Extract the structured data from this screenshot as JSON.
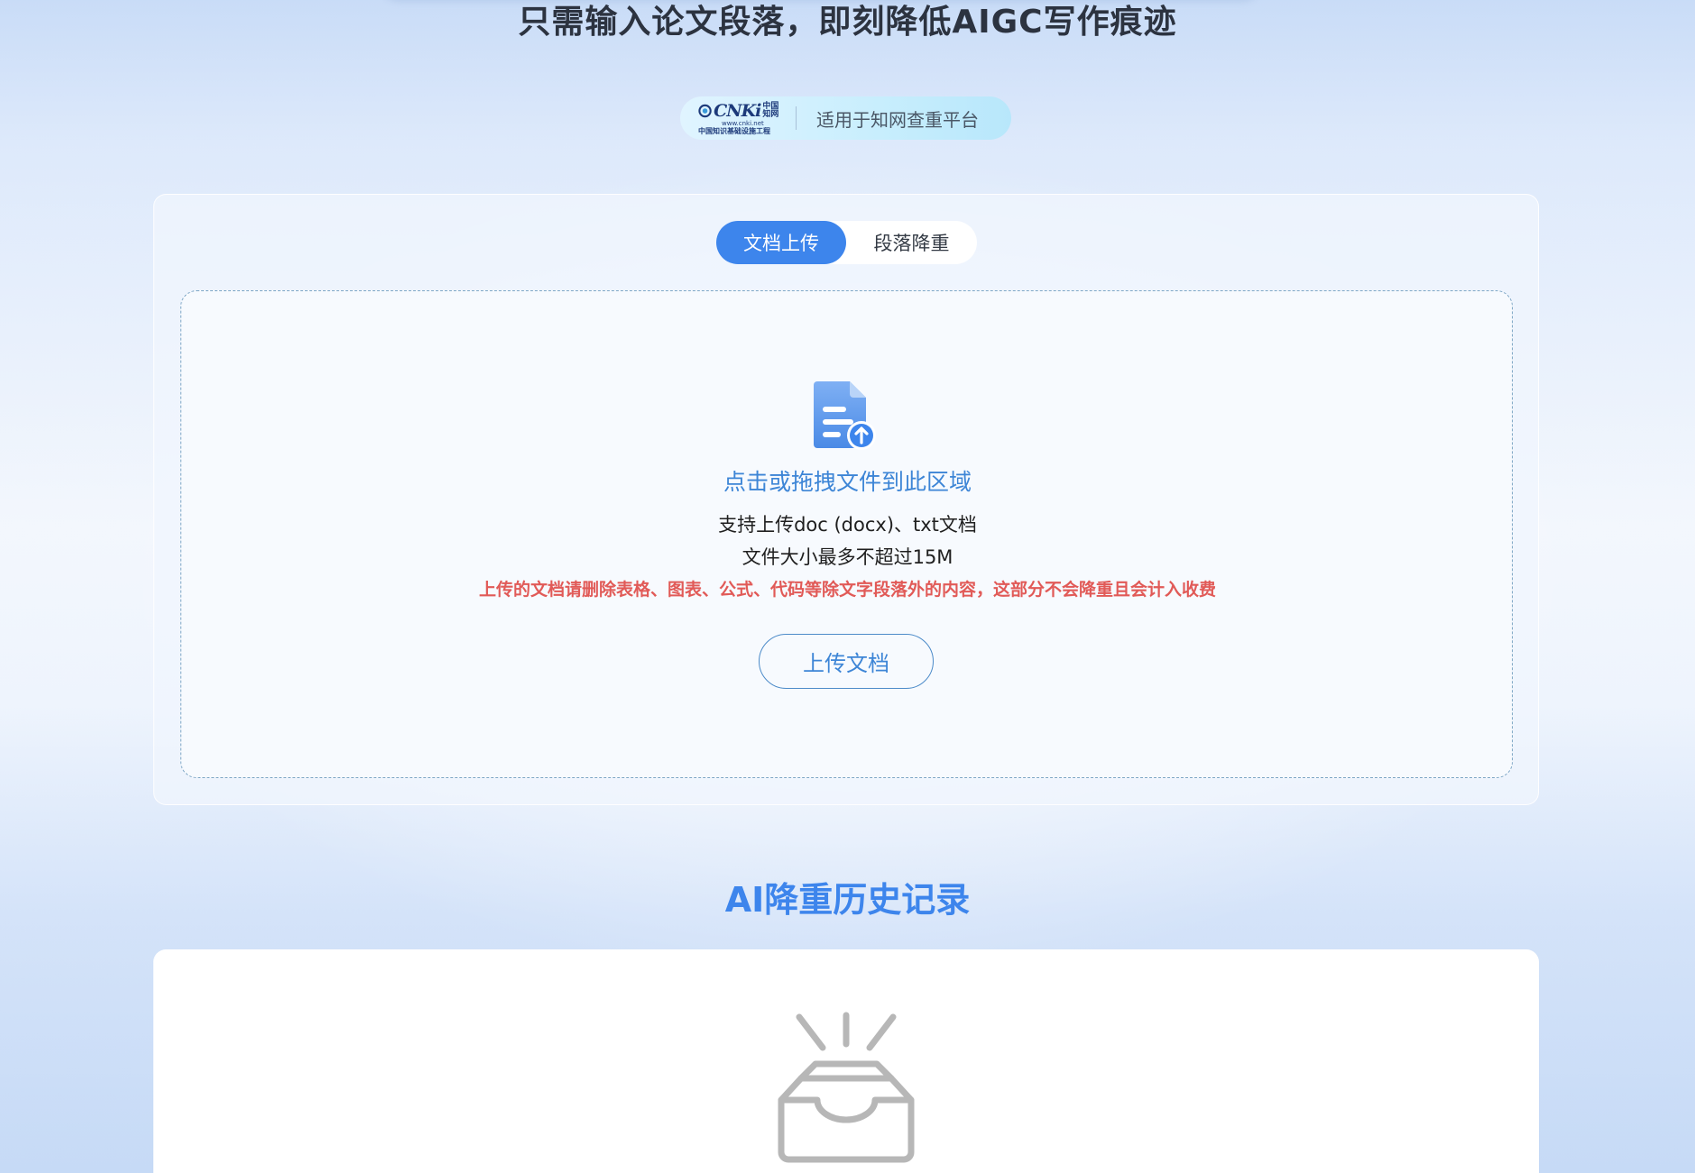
{
  "header": {
    "headline": "只需输入论文段落，即刻降低AIGC写作痕迹"
  },
  "platform_badge": {
    "logo_text": "CNKi",
    "logo_cn": "中国知网",
    "logo_url": "www.cnki.net",
    "logo_sub": "中国知识基础设施工程",
    "text": "适用于知网查重平台"
  },
  "tabs": [
    {
      "label": "文档上传",
      "active": true
    },
    {
      "label": "段落降重",
      "active": false
    }
  ],
  "upload": {
    "icon": "file-upload-icon",
    "title": "点击或拖拽文件到此区域",
    "support_text": "支持上传doc (docx)、txt文档",
    "size_text": "文件大小最多不超过15M",
    "warning": "上传的文档请删除表格、图表、公式、代码等除文字段落外的内容，这部分不会降重且会计入收费",
    "button_label": "上传文档"
  },
  "history": {
    "title": "AI降重历史记录",
    "empty_icon": "empty-inbox-icon"
  },
  "colors": {
    "accent": "#3d85ec",
    "accent_text": "#3d85d6",
    "warning": "#e15a57",
    "headline": "#2c3340"
  }
}
